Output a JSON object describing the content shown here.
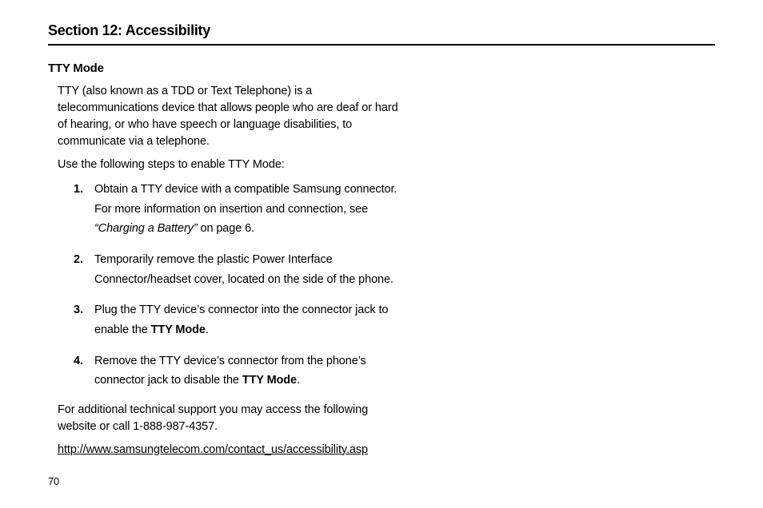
{
  "section": {
    "title": "Section 12: Accessibility"
  },
  "subsection": {
    "title": "TTY Mode"
  },
  "intro": {
    "p1": "TTY (also known as a TDD or Text Telephone) is a telecommunications device that allows people who are deaf or hard of hearing, or who have speech or language disabilities, to communicate via a telephone.",
    "p2": "Use the following steps to enable TTY Mode:"
  },
  "steps": [
    {
      "num": "1.",
      "t1": "Obtain a TTY device with a compatible Samsung connector. For more information on insertion and connection, see ",
      "em": "“Charging a Battery”",
      "t2": " on page 6."
    },
    {
      "num": "2.",
      "t1": "Temporarily remove the plastic Power Interface Connector/headset cover, located on the side of the phone."
    },
    {
      "num": "3.",
      "t1": "Plug the TTY device’s connector into the connector jack to enable the ",
      "strong": "TTY Mode",
      "t2": "."
    },
    {
      "num": "4.",
      "t1": "Remove the TTY device’s connector from the phone’s connector jack to disable the ",
      "strong": "TTY Mode",
      "t2": "."
    }
  ],
  "outro": {
    "p1": "For additional technical support you may access the following website or call 1-888-987-4357.",
    "url": "http://www.samsungtelecom.com/contact_us/accessibility.asp"
  },
  "page_number": "70"
}
